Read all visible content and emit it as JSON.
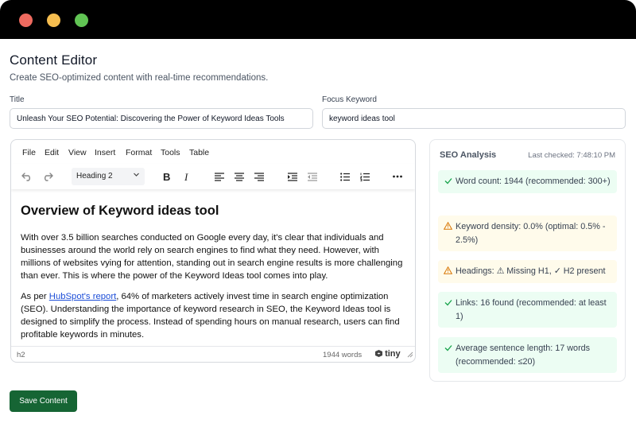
{
  "header": {
    "title": "Content Editor",
    "subtitle": "Create SEO-optimized content with real-time recommendations."
  },
  "form": {
    "title_label": "Title",
    "title_value": "Unleash Your SEO Potential: Discovering the Power of Keyword Ideas Tools",
    "keyword_label": "Focus Keyword",
    "keyword_value": "keyword ideas tool"
  },
  "editor": {
    "menu": [
      "File",
      "Edit",
      "View",
      "Insert",
      "Format",
      "Tools",
      "Table"
    ],
    "block_format": "Heading 2",
    "icons": [
      "undo-icon",
      "redo-icon",
      "bold-icon",
      "italic-icon",
      "align-left-icon",
      "align-center-icon",
      "align-right-icon",
      "indent-icon",
      "outdent-icon",
      "bullet-list-icon",
      "numbered-list-icon",
      "more-icon"
    ],
    "heading": "Overview of Keyword ideas tool",
    "paragraph1": "With over 3.5 billion searches conducted on Google every day, it's clear that individuals and businesses around the world rely on search engines to find what they need. However, with millions of websites vying for attention, standing out in search engine results is more challenging than ever. This is where the power of the Keyword Ideas tool comes into play.",
    "paragraph2_prefix": "As per ",
    "paragraph2_link": "HubSpot's report",
    "paragraph2_rest": ", 64% of marketers actively invest time in search engine optimization (SEO). Understanding the importance of keyword research in SEO, the Keyword Ideas tool is designed to simplify the process. Instead of spending hours on manual research, users can find profitable keywords in minutes.",
    "status_path": "h2",
    "word_count": "1944 words",
    "brand": "tiny"
  },
  "seo": {
    "title": "SEO Analysis",
    "last_checked": "Last checked: 7:48:10 PM",
    "items": [
      {
        "status": "ok",
        "icon": "check-icon",
        "text": "Word count: 1944 (recommended: 300+)"
      },
      {
        "status": "warn",
        "icon": "warning-icon",
        "text": "Keyword density: 0.0% (optimal: 0.5% - 2.5%)"
      },
      {
        "status": "warn",
        "icon": "warning-icon",
        "text": "Headings: ⚠ Missing H1, ✓ H2 present"
      },
      {
        "status": "ok",
        "icon": "check-icon",
        "text": "Links: 16 found (recommended: at least 1)"
      },
      {
        "status": "ok",
        "icon": "check-icon",
        "text": "Average sentence length: 17 words (recommended: ≤20)"
      }
    ]
  },
  "actions": {
    "save_label": "Save Content"
  },
  "colors": {
    "ok_bg": "#ecfdf3",
    "ok_icon": "#16a34a",
    "warn_bg": "#fffbeb",
    "warn_icon": "#d97706",
    "primary_button": "#166534",
    "link": "#1d4ed8"
  }
}
